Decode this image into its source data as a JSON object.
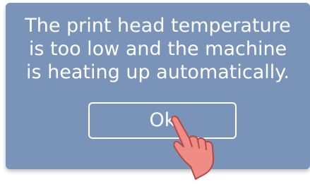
{
  "dialog": {
    "message": "The print head temperature\nis too low and the machine\nis heating up automatically.",
    "ok_label": "Ok",
    "background_color": "#7a93b8"
  },
  "overlay": {
    "icon": "pointing-hand-icon"
  }
}
